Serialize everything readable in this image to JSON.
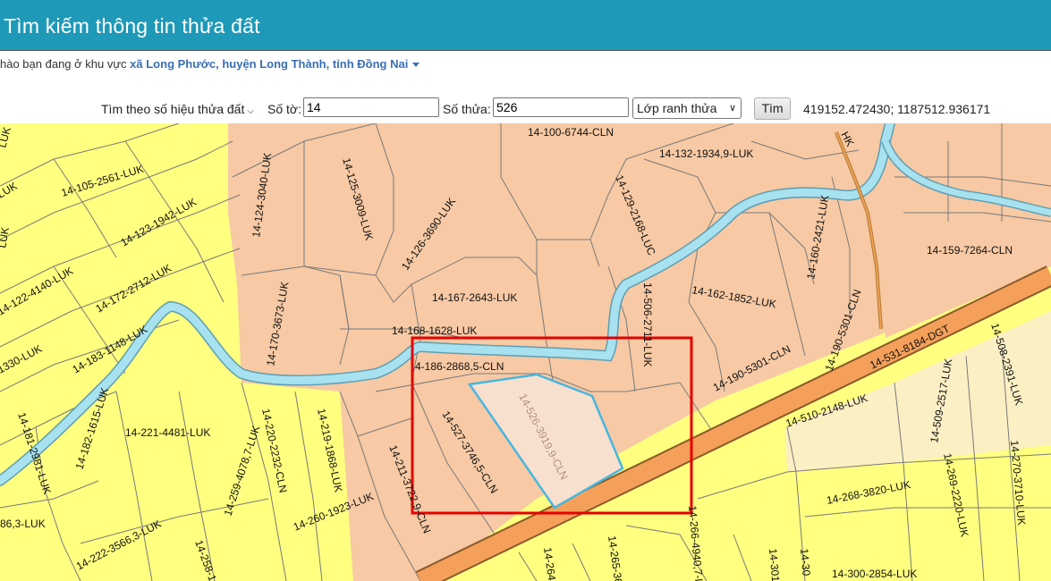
{
  "header": {
    "title": "Tìm kiếm thông tin thửa đất"
  },
  "greeting": {
    "prefix": "hào bạn đang ở khu vực",
    "location": "xã Long Phước, huyện Long Thành, tỉnh Đồng Nai"
  },
  "search": {
    "mode_label": "Tìm theo số hiệu thửa đất",
    "sheet_label": "Số tờ:",
    "sheet_value": "14",
    "parcel_label": "Số thửa:",
    "parcel_value": "526",
    "layer_value": "Lớp ranh thửa",
    "button_label": "Tìm",
    "coordinates": "419152.472430; 1187512.936171"
  },
  "colors": {
    "header": "#1e99b8",
    "residential_land": "#f7c9a4",
    "rice_land": "#ffff80",
    "road": "#f5a05a",
    "river": "#a8e1ef",
    "selected_parcel": "#f8e0cf",
    "selection_outline": "#47b6e0",
    "highlight_box": "#e60000"
  },
  "map": {
    "parcels": [
      "14-100-6744-CLN",
      "14-132-1934,9-LUK",
      "14-105-2561-LUK",
      "14-124-3040-LUK",
      "14-125-3009-LUK",
      "14-126-3690-LUK",
      "14-129-2168-LUC",
      "14-123-1942-LUK",
      "14-159-7264-CLN",
      "14-122-4140-LUK",
      "14-172-2712-LUK",
      "14-167-2643-LUK",
      "14-162-1852-LUK",
      "14-160-2421-LUK",
      "14-170-3673-LUK",
      "14-168-1628-LUK",
      "14-506-2711-LUK",
      "14-190-5301-CLN",
      "14-183-1148-LUK",
      "1330-LUK",
      "4-186-2868,5-CLN",
      "14-190-5301-CLN",
      "14-531-8184-DGT",
      "14-508-2391-LUK",
      "14-182-1615-LUK",
      "14-526-3919,9-CLN",
      "14-509-2517-LUK",
      "14-181-2981-LUK",
      "14-221-4481-LUK",
      "14-220-2232-CLN",
      "14-219-1868-LUK",
      "14-527-3746,5-CLN",
      "14-510-2148-LUK",
      "14-211-3722,9-CLN",
      "14-268-3820-LUK",
      "14-269-2220-LUK",
      "14-270-3710-LUK",
      "86,3-LUK",
      "14-222-3566,3-LUK",
      "14-260-1923-LUK",
      "14-259-4078,7-LUK",
      "14-258-1",
      "14-266-4940,7-LUK",
      "14-265-36",
      "14-264",
      "14-301",
      "14-300-2854-LUK",
      "LUK",
      "LUK",
      "LUK",
      "HK",
      "14-30"
    ]
  }
}
